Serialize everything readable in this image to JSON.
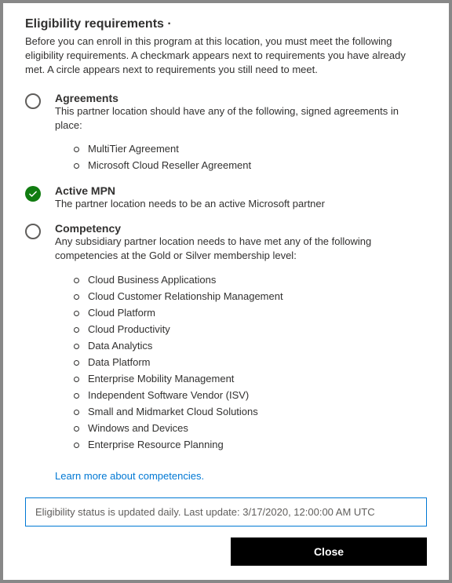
{
  "title": "Eligibility requirements ·",
  "intro": "Before you can enroll in this program at this location, you must meet the following eligibility requirements. A checkmark appears next to requirements you have already met. A circle appears next to requirements you still need to meet.",
  "requirements": [
    {
      "status": "incomplete",
      "title": "Agreements",
      "desc": "This partner location should have any of the following, signed agreements in place:",
      "items": [
        "MultiTier Agreement",
        "Microsoft Cloud Reseller Agreement"
      ]
    },
    {
      "status": "complete",
      "title": "Active MPN",
      "desc": "The partner location needs to be an active Microsoft partner",
      "items": []
    },
    {
      "status": "incomplete",
      "title": "Competency",
      "desc": "Any subsidiary partner location needs to have met any of the following competencies at the Gold or Silver membership level:",
      "items": [
        "Cloud Business Applications",
        "Cloud Customer Relationship Management",
        "Cloud Platform",
        "Cloud Productivity",
        "Data Analytics",
        "Data Platform",
        "Enterprise Mobility Management",
        "Independent Software Vendor (ISV)",
        "Small and Midmarket Cloud Solutions",
        "Windows and Devices",
        "Enterprise Resource Planning"
      ]
    }
  ],
  "learn_link": "Learn more about competencies.",
  "status_box": "Eligibility status is updated daily. Last update: 3/17/2020, 12:00:00 AM UTC",
  "close_label": "Close"
}
